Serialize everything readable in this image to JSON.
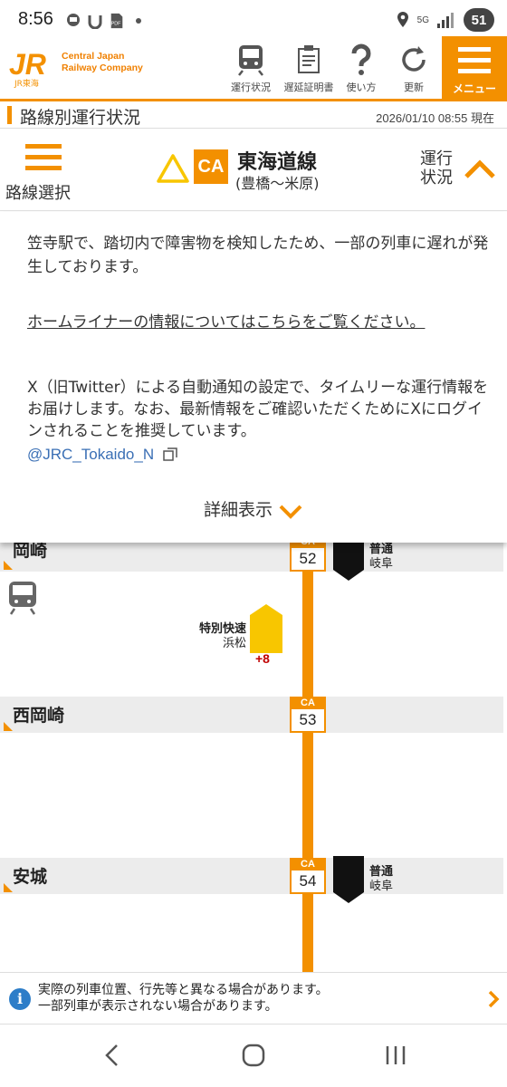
{
  "status_bar": {
    "time": "8:56",
    "network": "5G",
    "battery": "51"
  },
  "header": {
    "brand_line1": "Central Japan",
    "brand_line2": "Railway Company",
    "logo_sub": "JR東海",
    "buttons": [
      {
        "label": "運行状況",
        "icon": "train-icon"
      },
      {
        "label": "遅延証明書",
        "icon": "certificate-icon"
      },
      {
        "label": "使い方",
        "icon": "question-icon"
      },
      {
        "label": "更新",
        "icon": "refresh-icon"
      }
    ],
    "menu_label": "メニュー"
  },
  "titlebar": {
    "title": "路線別運行状況",
    "datetime": "2026/01/10 08:55 現在"
  },
  "line": {
    "select_label": "路線選択",
    "code": "CA",
    "name": "東海道線",
    "section": "(豊橋〜米原)",
    "status_label": "運行状況"
  },
  "message": {
    "text": "笠寺駅で、踏切内で障害物を検知したため、一部の列車に遅れが発生しております。",
    "homeliner_link": "ホームライナーの情報についてはこちらをご覧ください。",
    "twitter_text": "X（旧Twitter）による自動通知の設定で、タイムリーな運行情報をお届けします。なお、最新情報をご確認いただくためにXにログインされることを推奨しています。",
    "twitter_account": "@JRC_Tokaido_N",
    "detail_label": "詳細表示"
  },
  "stations": [
    {
      "name": "岡崎",
      "code": "CA",
      "num": "52"
    },
    {
      "name": "西岡崎",
      "code": "CA",
      "num": "53"
    },
    {
      "name": "安城",
      "code": "CA",
      "num": "54"
    }
  ],
  "trains": [
    {
      "type": "普通",
      "dest": "岐阜",
      "color": "#111111"
    },
    {
      "type": "特別快速",
      "dest": "浜松",
      "delay": "+8",
      "color": "#f8c600"
    },
    {
      "type": "普通",
      "dest": "岐阜",
      "color": "#111111"
    }
  ],
  "notice": {
    "line1": "実際の列車位置、行先等と異なる場合があります。",
    "line2": "一部列車が表示されない場合があります。"
  },
  "colors": {
    "accent": "#f39000",
    "link": "#3a6fb5",
    "delay": "#c00000",
    "rapid": "#f8c600",
    "info": "#2d7dc8"
  }
}
